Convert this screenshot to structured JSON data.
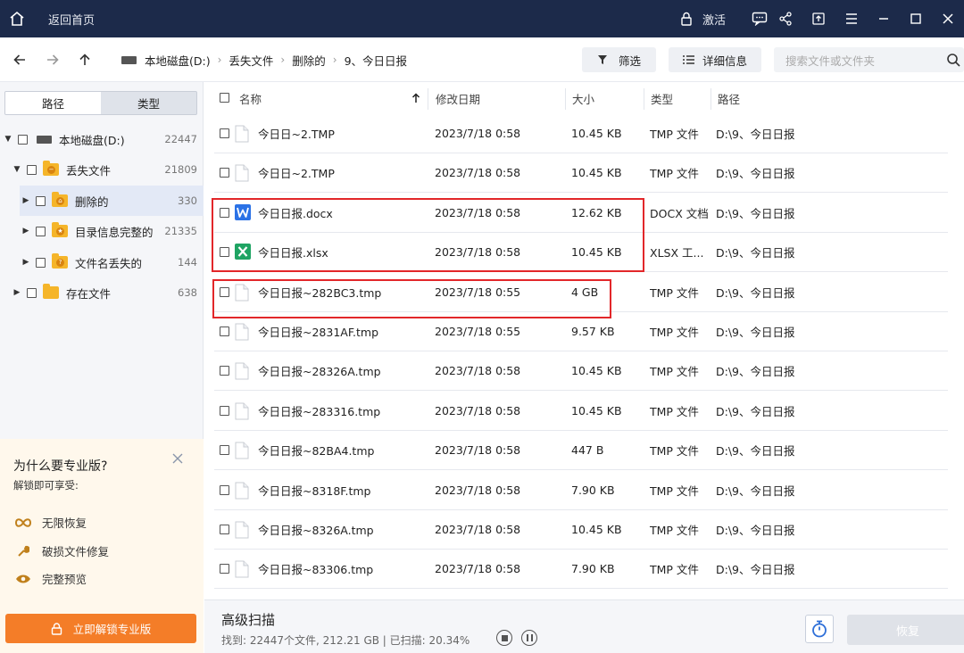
{
  "titlebar": {
    "back_label": "返回首页",
    "activate_label": "激活"
  },
  "breadcrumb": [
    "本地磁盘(D:)",
    "丢失文件",
    "删除的",
    "9、今日日报"
  ],
  "toolbar": {
    "filter_label": "筛选",
    "detail_label": "详细信息",
    "search_placeholder": "搜索文件或文件夹"
  },
  "sidebar": {
    "tabs": [
      "路径",
      "类型"
    ],
    "tree": [
      {
        "label": "本地磁盘(D:)",
        "count": "22447"
      },
      {
        "label": "丢失文件",
        "count": "21809"
      },
      {
        "label": "删除的",
        "count": "330"
      },
      {
        "label": "目录信息完整的",
        "count": "21335"
      },
      {
        "label": "文件名丢失的",
        "count": "144"
      },
      {
        "label": "存在文件",
        "count": "638"
      }
    ],
    "pro": {
      "title": "为什么要专业版?",
      "subtitle": "解锁即可享受:",
      "features": [
        "无限恢复",
        "破损文件修复",
        "完整预览"
      ],
      "button_label": "立即解锁专业版"
    }
  },
  "table": {
    "headers": {
      "name": "名称",
      "date": "修改日期",
      "size": "大小",
      "type": "类型",
      "path": "路径"
    },
    "rows": [
      {
        "name": "今日日~2.TMP",
        "date": "2023/7/18 0:58",
        "size": "10.45 KB",
        "type": "TMP 文件",
        "path": "D:\\9、今日日报",
        "icon": "file-icon"
      },
      {
        "name": "今日日~2.TMP",
        "date": "2023/7/18 0:58",
        "size": "10.45 KB",
        "type": "TMP 文件",
        "path": "D:\\9、今日日报",
        "icon": "file-icon"
      },
      {
        "name": "今日日报.docx",
        "date": "2023/7/18 0:58",
        "size": "12.62 KB",
        "type": "DOCX 文档",
        "path": "D:\\9、今日日报",
        "icon": "word-icon"
      },
      {
        "name": "今日日报.xlsx",
        "date": "2023/7/18 0:58",
        "size": "10.45 KB",
        "type": "XLSX 工...",
        "path": "D:\\9、今日日报",
        "icon": "excel-icon"
      },
      {
        "name": "今日日报~282BC3.tmp",
        "date": "2023/7/18 0:55",
        "size": "4 GB",
        "type": "TMP 文件",
        "path": "D:\\9、今日日报",
        "icon": "file-icon"
      },
      {
        "name": "今日日报~2831AF.tmp",
        "date": "2023/7/18 0:55",
        "size": "9.57 KB",
        "type": "TMP 文件",
        "path": "D:\\9、今日日报",
        "icon": "file-icon"
      },
      {
        "name": "今日日报~28326A.tmp",
        "date": "2023/7/18 0:58",
        "size": "10.45 KB",
        "type": "TMP 文件",
        "path": "D:\\9、今日日报",
        "icon": "file-icon"
      },
      {
        "name": "今日日报~283316.tmp",
        "date": "2023/7/18 0:58",
        "size": "10.45 KB",
        "type": "TMP 文件",
        "path": "D:\\9、今日日报",
        "icon": "file-icon"
      },
      {
        "name": "今日日报~82BA4.tmp",
        "date": "2023/7/18 0:58",
        "size": "447 B",
        "type": "TMP 文件",
        "path": "D:\\9、今日日报",
        "icon": "file-icon"
      },
      {
        "name": "今日日报~8318F.tmp",
        "date": "2023/7/18 0:58",
        "size": "7.90 KB",
        "type": "TMP 文件",
        "path": "D:\\9、今日日报",
        "icon": "file-icon"
      },
      {
        "name": "今日日报~8326A.tmp",
        "date": "2023/7/18 0:58",
        "size": "10.45 KB",
        "type": "TMP 文件",
        "path": "D:\\9、今日日报",
        "icon": "file-icon"
      },
      {
        "name": "今日日报~83306.tmp",
        "date": "2023/7/18 0:58",
        "size": "7.90 KB",
        "type": "TMP 文件",
        "path": "D:\\9、今日日报",
        "icon": "file-icon"
      }
    ]
  },
  "scan": {
    "title": "高级扫描",
    "stats": "找到: 22447个文件, 212.21 GB | 已扫描: 20.34%",
    "recover_label": "恢复"
  },
  "colors": {
    "titlebar": "#1c2a4a",
    "accent_orange": "#f47d28",
    "highlight_red": "#e2272a",
    "folder": "#f5b52a"
  }
}
